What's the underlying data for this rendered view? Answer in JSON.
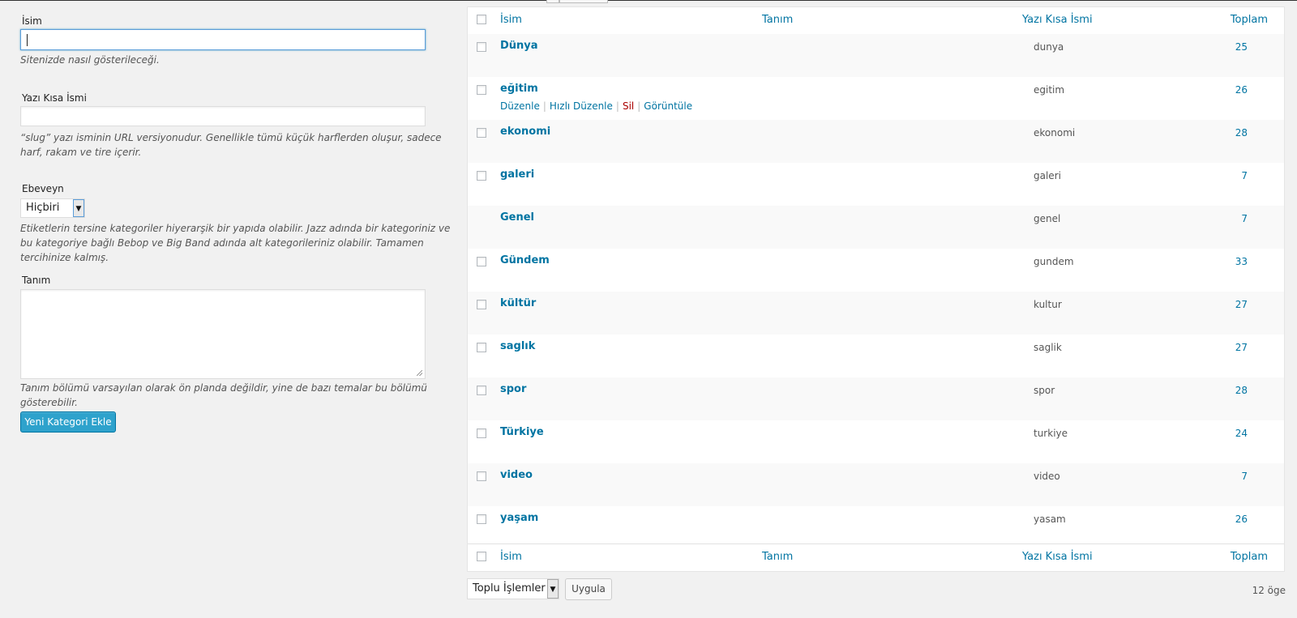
{
  "form": {
    "name_label": "İsim",
    "name_value": "",
    "name_help": "Sitenizde nasıl gösterileceği.",
    "slug_label": "Yazı Kısa İsmi",
    "slug_value": "",
    "slug_help": "“slug” yazı isminin URL versiyonudur. Genellikle tümü küçük harflerden oluşur, sadece harf, rakam ve tire içerir.",
    "parent_label": "Ebeveyn",
    "parent_value": "Hiçbiri",
    "parent_help": "Etiketlerin tersine kategoriler hiyerarşik bir yapıda olabilir. Jazz adında bir kategoriniz ve bu kategoriye bağlı Bebop ve Big Band adında alt kategorileriniz olabilir. Tamamen tercihinize kalmış.",
    "desc_label": "Tanım",
    "desc_value": "",
    "desc_help": "Tanım bölümü varsayılan olarak ön planda değildir, yine de bazı temalar bu bölümü gösterebilir.",
    "submit_label": "Yeni Kategori Ekle"
  },
  "table": {
    "columns": {
      "name": "İsim",
      "description": "Tanım",
      "slug": "Yazı Kısa İsmi",
      "count": "Toplam"
    },
    "rows": [
      {
        "name": "Dünya",
        "slug": "dunya",
        "count": "25",
        "checkbox": true
      },
      {
        "name": "eğitim",
        "slug": "egitim",
        "count": "26",
        "checkbox": true
      },
      {
        "name": "ekonomi",
        "slug": "ekonomi",
        "count": "28",
        "checkbox": true
      },
      {
        "name": "galeri",
        "slug": "galeri",
        "count": "7",
        "checkbox": true
      },
      {
        "name": "Genel",
        "slug": "genel",
        "count": "7",
        "checkbox": false
      },
      {
        "name": "Gündem",
        "slug": "gundem",
        "count": "33",
        "checkbox": true
      },
      {
        "name": "kültür",
        "slug": "kultur",
        "count": "27",
        "checkbox": true
      },
      {
        "name": "saglık",
        "slug": "saglik",
        "count": "27",
        "checkbox": true
      },
      {
        "name": "spor",
        "slug": "spor",
        "count": "28",
        "checkbox": true
      },
      {
        "name": "Türkiye",
        "slug": "turkiye",
        "count": "24",
        "checkbox": true
      },
      {
        "name": "video",
        "slug": "video",
        "count": "7",
        "checkbox": true
      },
      {
        "name": "yaşam",
        "slug": "yasam",
        "count": "26",
        "checkbox": true
      }
    ],
    "row_actions": {
      "edit": "Düzenle",
      "quick_edit": "Hızlı Düzenle",
      "delete": "Sil",
      "view": "Görüntüle"
    }
  },
  "bulk": {
    "select_value": "Toplu İşlemler",
    "apply_label": "Uygula",
    "items_count": "12 öge"
  }
}
